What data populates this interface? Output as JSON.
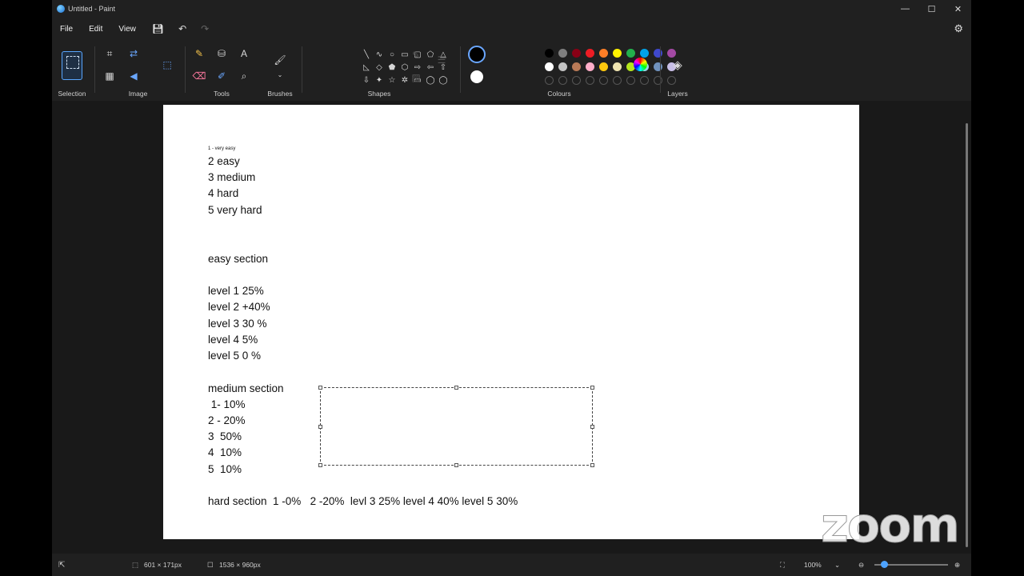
{
  "window": {
    "title": "Untitled - Paint",
    "controls": [
      "—",
      "☐",
      "✕"
    ]
  },
  "menu": {
    "file": "File",
    "edit": "Edit",
    "view": "View"
  },
  "ribbon": {
    "groups": {
      "selection": "Selection",
      "image": "Image",
      "tools": "Tools",
      "brushes": "Brushes",
      "shapes": "Shapes",
      "colours": "Colours",
      "layers": "Layers"
    },
    "shape_glyphs": [
      "╲",
      "∿",
      "○",
      "▭",
      "▢",
      "⬠",
      "△",
      "◺",
      "◇",
      "⬟",
      "⬡",
      "⇨",
      "⇦",
      "⇧",
      "⇩",
      "✦",
      "☆",
      "✲",
      "▭",
      "◯",
      "◯"
    ],
    "colors": {
      "row1": [
        "#000000",
        "#7f7f7f",
        "#880015",
        "#ed1c24",
        "#ff7f27",
        "#fff200",
        "#22b14c",
        "#00a2e8",
        "#3f48cc",
        "#a349a4"
      ],
      "row2": [
        "#ffffff",
        "#c3c3c3",
        "#b97a57",
        "#ffaec9",
        "#ffc90e",
        "#efe4b0",
        "#b5e61d",
        "#99d9ea",
        "#7092be",
        "#c8bfe7"
      ],
      "primary": "#000000",
      "secondary": "#ffffff"
    }
  },
  "canvas_text": {
    "l1": "1 - very easy",
    "l2": "2 easy",
    "l3": "3 medium",
    "l4": "4 hard",
    "l5": "5 very hard",
    "easy_title": "easy section",
    "e1": "level 1 25%",
    "e2": "level 2 +40%",
    "e3": "level 3 30 %",
    "e4": "level 4 5%",
    "e5": "level 5 0 %",
    "medium_title": "medium section",
    "m1": " 1- 10%",
    "m2": "2 - 20%",
    "m3": "3  50%",
    "m4": "4  10%",
    "m5": "5  10%",
    "hard": "hard section  1 -0%   2 -20%  levl 3 25% level 4 40% level 5 30%"
  },
  "status": {
    "selection_size": "601 × 171px",
    "canvas_size": "1536 × 960px",
    "zoom": "100%"
  },
  "overlay": {
    "logo": "zoom"
  }
}
